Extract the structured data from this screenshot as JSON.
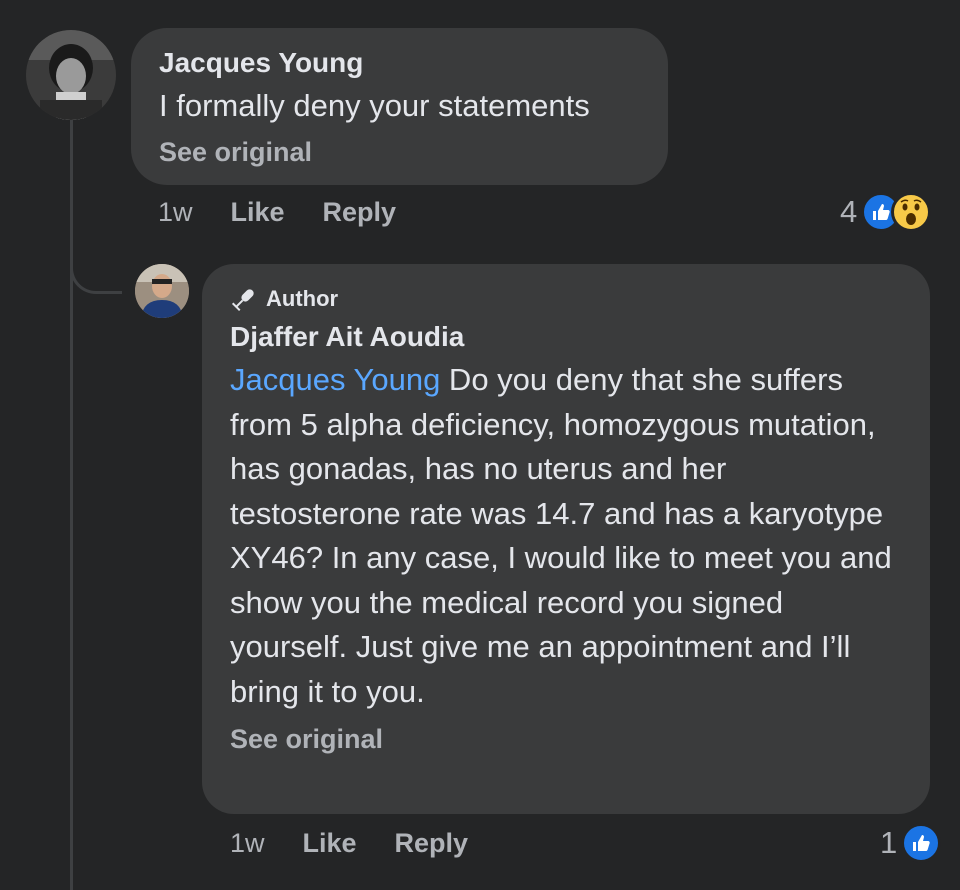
{
  "comment": {
    "author": "Jacques Young",
    "text": "I formally deny your statements",
    "see_original": "See original",
    "time": "1w",
    "like_label": "Like",
    "reply_label": "Reply",
    "reaction_count": "4",
    "reaction_icons": [
      "like-icon",
      "wow-icon"
    ]
  },
  "reply": {
    "badge": "Author",
    "badge_icon": "microphone-icon",
    "author": "Djaffer Ait Aoudia",
    "mention": "Jacques Young",
    "text": " Do you deny that she suffers from 5 alpha deficiency, homozygous mutation, has gonadas, has no uterus and her testosterone rate was 14.7 and has a karyotype XY46? In any case, I would like to meet you and show you the medical record you signed yourself. Just give me an appointment and I’ll bring it to you.",
    "see_original": "See original",
    "time": "1w",
    "like_label": "Like",
    "reply_label": "Reply",
    "reaction_count": "1",
    "reaction_icons": [
      "like-icon"
    ]
  },
  "colors": {
    "background": "#242526",
    "bubble": "#3a3b3c",
    "mention": "#5aa7ff",
    "like_blue": "#1b74e4",
    "wow_yellow": "#f7c948"
  }
}
